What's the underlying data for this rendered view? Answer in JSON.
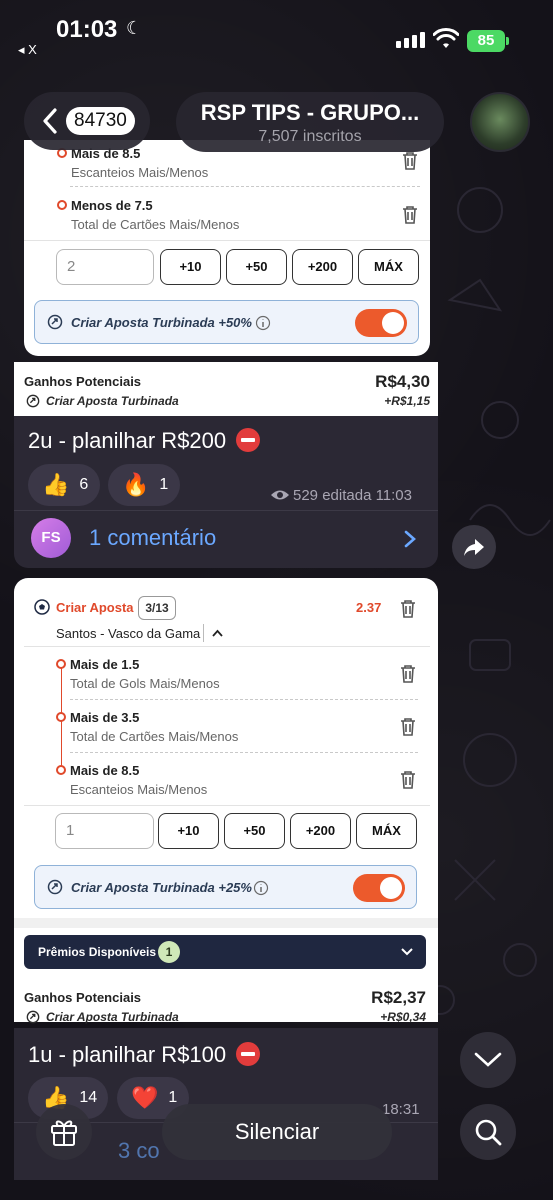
{
  "status_bar": {
    "time": "01:03",
    "back_app": "◂ X",
    "battery": "85"
  },
  "header": {
    "back_count": "84730",
    "title": "RSP TIPS - GRUPO...",
    "subtitle": "7,507 inscritos"
  },
  "post1": {
    "bets": [
      {
        "title": "Mais de 8.5",
        "market": "Escanteios Mais/Menos"
      },
      {
        "title": "Menos de 7.5",
        "market": "Total de Cartões Mais/Menos"
      }
    ],
    "stake_value": "2",
    "stake_buttons": [
      "+10",
      "+50",
      "+200",
      "MÁX"
    ],
    "boost_label": "Criar Aposta Turbinada +50%",
    "gains_label": "Ganhos Potenciais",
    "gains_value": "R$4,30",
    "gains_sub": "Criar Aposta Turbinada",
    "gains_bonus": "+R$1,15",
    "caption": "2u - planilhar R$200",
    "reactions": [
      {
        "emoji": "👍",
        "count": "6"
      },
      {
        "emoji": "🔥",
        "count": "1"
      }
    ],
    "meta": "529 editada 11:03",
    "commenter_initials": "FS",
    "comments": "1 comentário"
  },
  "post2": {
    "header_label": "Criar Aposta",
    "header_count": "3/13",
    "odds": "2.37",
    "match": "Santos - Vasco da Gama",
    "bets": [
      {
        "title": "Mais de 1.5",
        "market": "Total de Gols Mais/Menos"
      },
      {
        "title": "Mais de 3.5",
        "market": "Total de Cartões Mais/Menos"
      },
      {
        "title": "Mais de 8.5",
        "market": "Escanteios Mais/Menos"
      }
    ],
    "stake_value": "1",
    "stake_buttons": [
      "+10",
      "+50",
      "+200",
      "MÁX"
    ],
    "boost_label": "Criar Aposta Turbinada +25%",
    "prizes_label": "Prêmios Disponíveis",
    "prizes_count": "1",
    "gains_label": "Ganhos Potenciais",
    "gains_value": "R$2,37",
    "gains_sub": "Criar Aposta Turbinada",
    "gains_bonus": "+R$0,34",
    "caption": "1u - planilhar R$100",
    "reactions": [
      {
        "emoji": "👍",
        "count": "14"
      },
      {
        "emoji": "❤️",
        "count": "1"
      }
    ],
    "meta": "18:31",
    "comments": "3 co"
  },
  "bottom": {
    "mute_label": "Silenciar"
  },
  "colors": {
    "accent_orange": "#ec5a2c",
    "link_blue": "#6ba8ff",
    "battery_green": "#4cd964"
  }
}
